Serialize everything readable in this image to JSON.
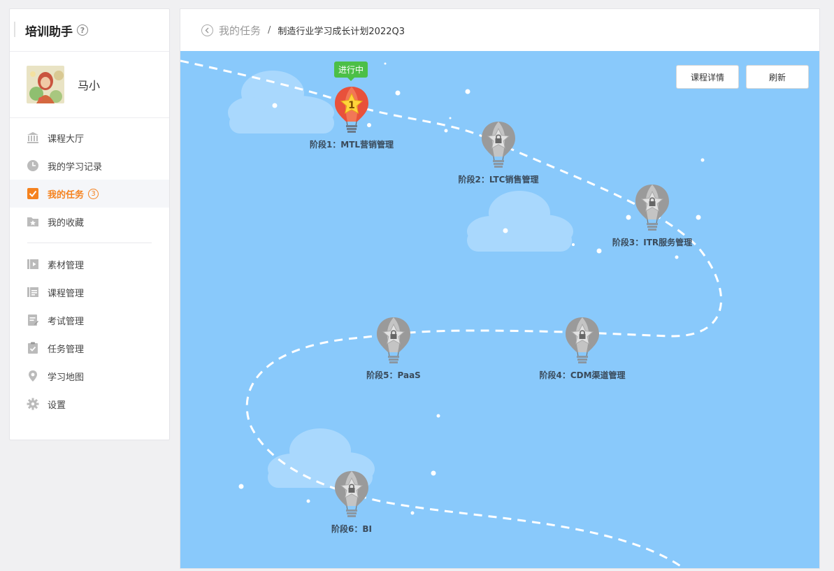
{
  "sidebar": {
    "title": "培训助手",
    "help_icon": "?",
    "user": {
      "name": "马小"
    },
    "nav_main": [
      {
        "label": "课程大厅",
        "icon": "bank-icon"
      },
      {
        "label": "我的学习记录",
        "icon": "clock-icon"
      },
      {
        "label": "我的任务",
        "icon": "checkbox-icon",
        "badge": "3",
        "active": true
      },
      {
        "label": "我的收藏",
        "icon": "star-folder-icon"
      }
    ],
    "nav_admin": [
      {
        "label": "素材管理",
        "icon": "video-icon"
      },
      {
        "label": "课程管理",
        "icon": "course-icon"
      },
      {
        "label": "考试管理",
        "icon": "exam-icon"
      },
      {
        "label": "任务管理",
        "icon": "task-icon"
      },
      {
        "label": "学习地图",
        "icon": "location-icon"
      },
      {
        "label": "设置",
        "icon": "gear-icon"
      }
    ]
  },
  "breadcrumb": {
    "back": "我的任务",
    "separator": "/",
    "current": "制造行业学习成长计划2022Q3"
  },
  "buttons": {
    "details": "课程详情",
    "refresh": "刷新"
  },
  "map": {
    "active_tag": "进行中",
    "active_number": "1",
    "stages": [
      {
        "label": "阶段1：MTL营销管理",
        "status": "active"
      },
      {
        "label": "阶段2：LTC销售管理",
        "status": "locked"
      },
      {
        "label": "阶段3：ITR服务管理",
        "status": "locked"
      },
      {
        "label": "阶段4：CDM渠道管理",
        "status": "locked"
      },
      {
        "label": "阶段5：PaaS",
        "status": "locked"
      },
      {
        "label": "阶段6：BI",
        "status": "locked"
      }
    ]
  },
  "colors": {
    "accent": "#f5821f",
    "map_bg": "#89c9fb",
    "tag_green": "#4cbf47",
    "balloon_red": "#e8513b",
    "balloon_gray": "#9a9a9a"
  }
}
